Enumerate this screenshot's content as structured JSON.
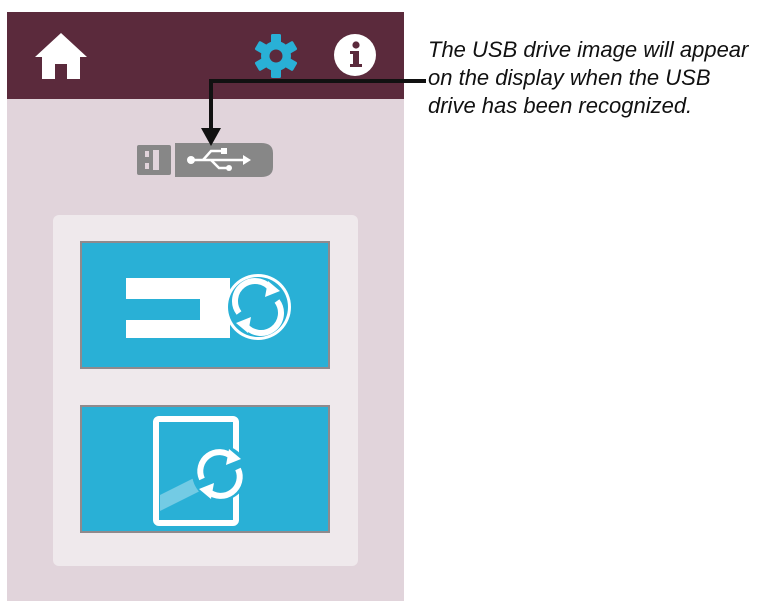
{
  "callout": {
    "text": "The USB drive image will appear on the display when the USB drive has been recognized."
  },
  "icons": {
    "home": "home-icon",
    "settings": "gear-icon",
    "info": "info-icon",
    "usb": "usb-drive-icon",
    "machine_sync": "sewing-machine-sync-icon",
    "tablet_sync": "tablet-sync-icon"
  },
  "colors": {
    "topbar": "#5b2a3c",
    "background": "#e1d4db",
    "tile": "#29b0d6",
    "gear": "#29b0d6",
    "usb": "#878787"
  }
}
